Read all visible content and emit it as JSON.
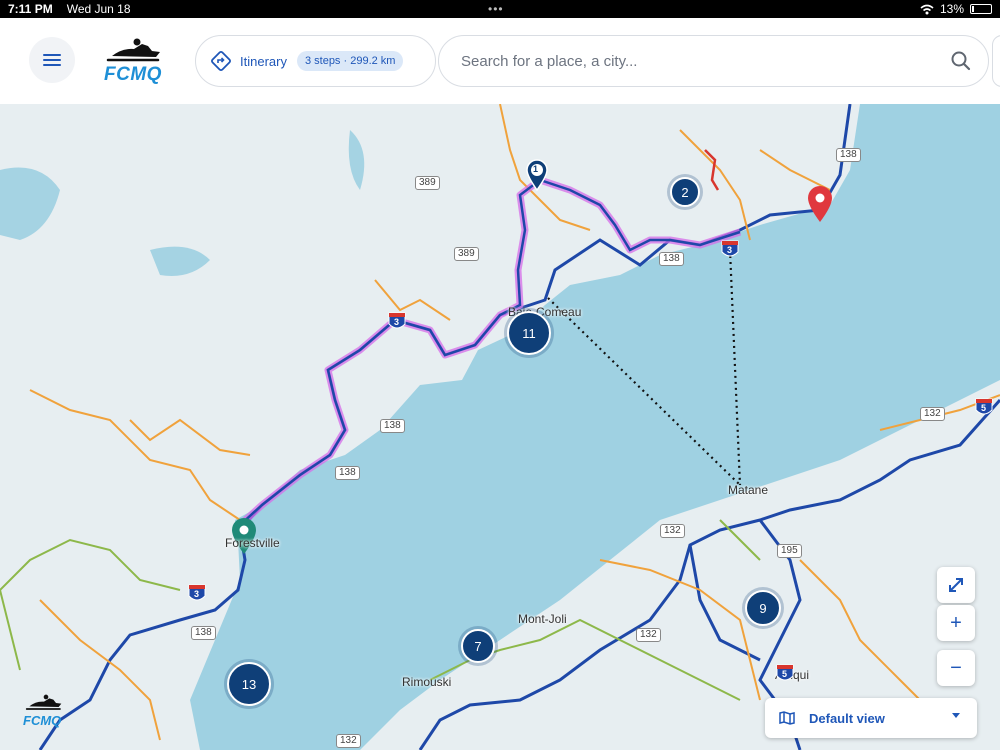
{
  "status_bar": {
    "time": "7:11 PM",
    "date": "Wed Jun 18",
    "battery": "13%",
    "battery_level": 0.13,
    "icons": [
      "wifi-icon",
      "battery-icon"
    ]
  },
  "header": {
    "menu_icon": "hamburger-icon",
    "logo_text": "FCMQ",
    "itinerary": {
      "label": "Itinerary",
      "steps": "3 steps",
      "distance": "299.2 km",
      "icon": "directions-icon"
    },
    "search": {
      "placeholder": "Search for a place, a city...",
      "icon": "search-icon"
    }
  },
  "map": {
    "place_labels": [
      "Baie-Comeau",
      "Forestville",
      "Matane",
      "Mont-Joli",
      "Rimouski",
      "Amqui"
    ],
    "route_numbers": [
      "389",
      "389",
      "138",
      "138",
      "138",
      "138",
      "138",
      "132",
      "132",
      "132",
      "132",
      "195"
    ],
    "trail_shields": [
      "3",
      "3",
      "3",
      "3",
      "5",
      "5"
    ],
    "clusters": [
      "2",
      "11",
      "13",
      "7",
      "9"
    ],
    "step_marker": "1",
    "colors": {
      "water": "#9fd1e2",
      "land": "#e6eef2",
      "trail_local": "#f0a23c",
      "trail_regional": "#8db84a",
      "trail_federated": "#1e48a8",
      "route_highlight": "#d66ce8",
      "cluster": "#0f3f78",
      "marker_start": "#0f3f78",
      "marker_end": "#e0383e",
      "marker_mid": "#1f8a78"
    }
  },
  "controls": {
    "fullscreen_icon": "expand-icon",
    "zoom_in": "+",
    "zoom_out": "−",
    "view_selector": {
      "label": "Default view",
      "icon": "map-icon",
      "caret_icon": "caret-down-icon"
    }
  },
  "watermark": {
    "text": "FCMQ"
  }
}
